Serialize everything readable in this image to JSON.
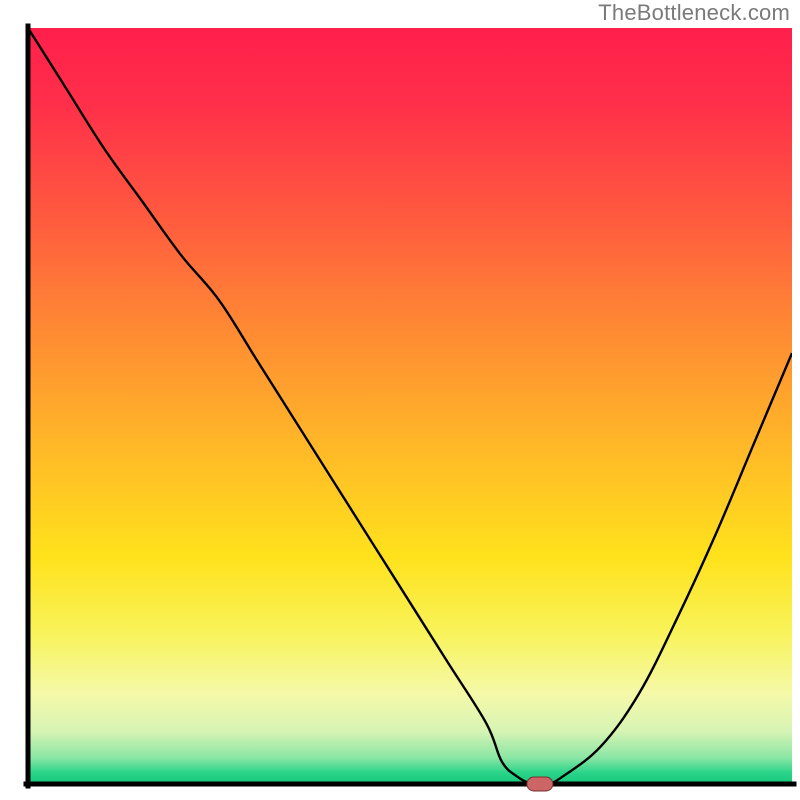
{
  "watermark": "TheBottleneck.com",
  "chart_data": {
    "type": "line",
    "title": "",
    "xlabel": "",
    "ylabel": "",
    "xlim": [
      0,
      100
    ],
    "ylim": [
      0,
      100
    ],
    "x": [
      0,
      5,
      10,
      15,
      20,
      25,
      30,
      35,
      40,
      45,
      50,
      55,
      60,
      62,
      64,
      66,
      68,
      70,
      75,
      80,
      85,
      90,
      95,
      100
    ],
    "values": [
      100,
      92,
      84,
      77,
      70,
      64,
      56,
      48,
      40,
      32,
      24,
      16,
      8,
      3,
      1,
      0,
      0,
      1,
      5,
      12,
      22,
      33,
      45,
      57
    ],
    "marker": {
      "x": 67,
      "y": 0
    },
    "gradient_stops": [
      {
        "offset": 0.0,
        "color": "#ff1f4b"
      },
      {
        "offset": 0.1,
        "color": "#ff2f4a"
      },
      {
        "offset": 0.25,
        "color": "#ff5a3f"
      },
      {
        "offset": 0.4,
        "color": "#ff8a33"
      },
      {
        "offset": 0.55,
        "color": "#ffb728"
      },
      {
        "offset": 0.7,
        "color": "#ffe21c"
      },
      {
        "offset": 0.8,
        "color": "#f8f35a"
      },
      {
        "offset": 0.88,
        "color": "#f5f9a8"
      },
      {
        "offset": 0.93,
        "color": "#d7f4b4"
      },
      {
        "offset": 0.965,
        "color": "#8be6a4"
      },
      {
        "offset": 0.985,
        "color": "#2bd48a"
      },
      {
        "offset": 1.0,
        "color": "#14c97a"
      }
    ],
    "axis_color": "#000000",
    "curve_color": "#000000",
    "marker_fill": "#cc6666",
    "marker_stroke": "#7a2f2f"
  }
}
